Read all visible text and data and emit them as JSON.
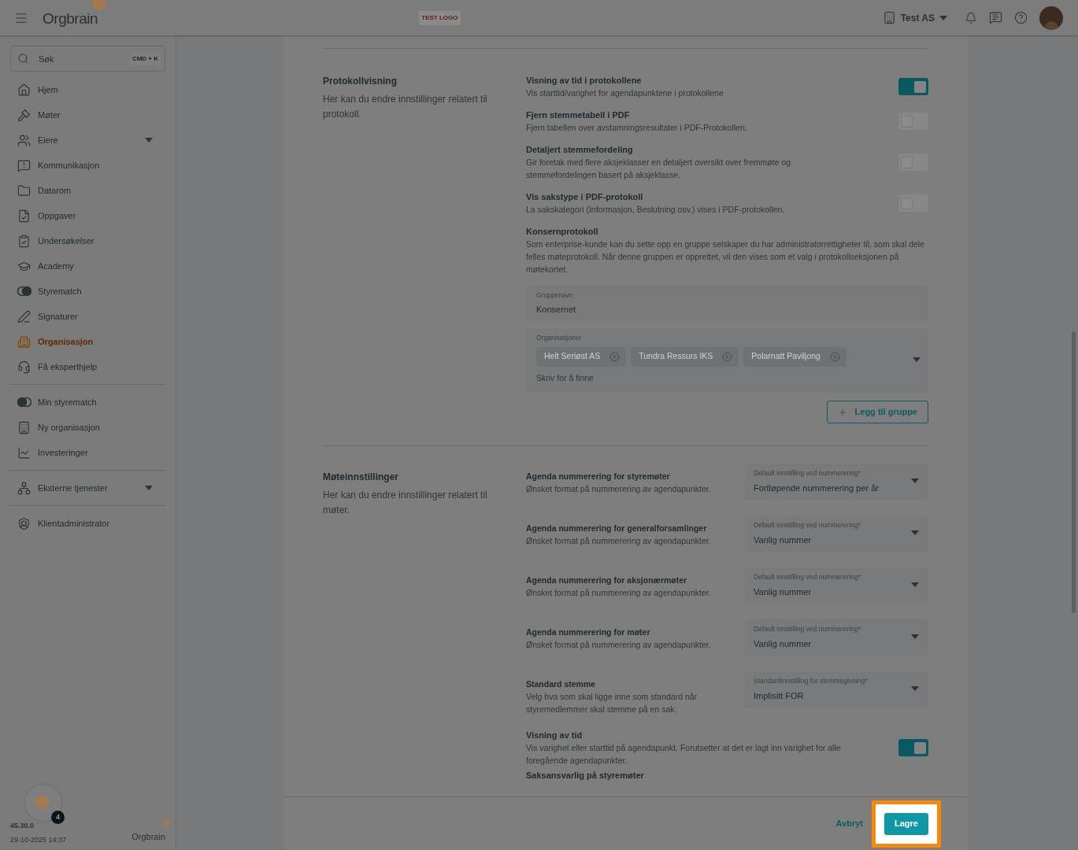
{
  "header": {
    "brand": "Orgbrain",
    "test_logo": "TEST LOGO",
    "org_switcher": "Test AS"
  },
  "sidebar": {
    "search": {
      "placeholder": "Søk",
      "shortcut": "CMD + K"
    },
    "groups": [
      [
        {
          "label": "Hjem",
          "selected": false,
          "expandable": false
        },
        {
          "label": "Møter",
          "selected": false,
          "expandable": false
        },
        {
          "label": "Eiere",
          "selected": false,
          "expandable": true
        },
        {
          "label": "Kommunikasjon",
          "selected": false,
          "expandable": false
        },
        {
          "label": "Datarom",
          "selected": false,
          "expandable": false
        },
        {
          "label": "Oppgaver",
          "selected": false,
          "expandable": false
        },
        {
          "label": "Undersøkelser",
          "selected": false,
          "expandable": false
        },
        {
          "label": "Academy",
          "selected": false,
          "expandable": false
        },
        {
          "label": "Styrematch",
          "selected": false,
          "expandable": false
        },
        {
          "label": "Signaturer",
          "selected": false,
          "expandable": false
        },
        {
          "label": "Organisasjon",
          "selected": true,
          "expandable": false
        },
        {
          "label": "Få eksperthjelp",
          "selected": false,
          "expandable": false
        }
      ],
      [
        {
          "label": "Min styrematch",
          "selected": false,
          "expandable": false
        },
        {
          "label": "Ny organisasjon",
          "selected": false,
          "expandable": false
        },
        {
          "label": "Investeringer",
          "selected": false,
          "expandable": false
        }
      ],
      [
        {
          "label": "Eksterne tjenester",
          "selected": false,
          "expandable": true
        }
      ],
      [
        {
          "label": "Klientadministrator",
          "selected": false,
          "expandable": false
        }
      ]
    ],
    "assistant_badge": "4",
    "version": "45.30.0",
    "timestamp": "29-10-2025 14:37",
    "footer_brand": "Orgbrain"
  },
  "protocol_section": {
    "title": "Protokollvisning",
    "description": "Her kan du endre innstillinger relatert til protokoll.",
    "settings": [
      {
        "title": "Visning av tid i protokollene",
        "description": "Vis starttid/varighet for agendapunktene i protokollene",
        "on": true
      },
      {
        "title": "Fjern stemmetabell i PDF",
        "description": "Fjern tabellen over avstamningsresultater i PDF-Protokollen.",
        "on": false
      },
      {
        "title": "Detaljert stemmefordeling",
        "description": "Gir foretak med flere aksjeklasser en detaljert oversikt over fremmøte og stemmefordelingen basert på aksjeklasse.",
        "on": false
      },
      {
        "title": "Vis sakstype i PDF-protokoll",
        "description": "La sakskategori (Informasjon, Beslutning osv.) vises i PDF-protokollen.",
        "on": false
      }
    ],
    "group_protocol": {
      "title": "Konsernprotokoll",
      "description": "Som enterprise-kunde kan du sette opp en gruppe selskaper du har administratorrettigheter til, som skal dele felles møteprotokoll. Når denne gruppen er opprettet, vil den vises som et valg i protokollseksjonen på møtekortet.",
      "group_name": {
        "label": "Gruppenavn",
        "value": "Konsernet"
      },
      "organizations": {
        "label": "Organisasjoner",
        "chips": [
          "Helt Seriøst AS",
          "Tundra Ressurs IKS",
          "Polarnatt Paviljong"
        ],
        "placeholder": "Skriv for å finne"
      },
      "add_button": "Legg til gruppe"
    }
  },
  "meeting_section": {
    "title": "Møteinnstillinger",
    "description": "Her kan du endre innstillinger relatert til møter.",
    "settings": [
      {
        "kind": "select",
        "title": "Agenda nummerering for styremøter",
        "description": "Ønsket format på nummerering av agendapunkter.",
        "select_label": "Default innstilling ved nummerering*",
        "value": "Fortløpende nummerering per år"
      },
      {
        "kind": "select",
        "title": "Agenda nummerering for generalforsamlinger",
        "description": "Ønsket format på nummerering av agendapunkter.",
        "select_label": "Default innstilling ved nummerering*",
        "value": "Vanlig nummer"
      },
      {
        "kind": "select",
        "title": "Agenda nummerering for aksjonærmøter",
        "description": "Ønsket format på nummerering av agendapunkter.",
        "select_label": "Default innstilling ved nummerering*",
        "value": "Vanlig nummer"
      },
      {
        "kind": "select",
        "title": "Agenda nummerering for møter",
        "description": "Ønsket format på nummerering av agendapunkter.",
        "select_label": "Default innstilling ved nummerering*",
        "value": "Vanlig nummer"
      },
      {
        "kind": "select",
        "title": "Standard stemme",
        "description": "Velg hva som skal ligge inne som standard når styremedlemmer skal stemme på en sak.",
        "select_label": "Standardinnstilling for stemmegivning*",
        "value": "Implisitt FOR"
      },
      {
        "kind": "toggle",
        "title": "Visning av tid",
        "description": "Vis varighet eller starttid på agendapunkt. Forutsetter at det er lagt inn varighet for alle foregående agendapunkter.",
        "on": true
      },
      {
        "kind": "heading",
        "title": "Saksansvarlig på styremøter"
      }
    ]
  },
  "footer": {
    "cancel": "Avbryt",
    "save": "Lagre",
    "save_highlighted": true
  }
}
